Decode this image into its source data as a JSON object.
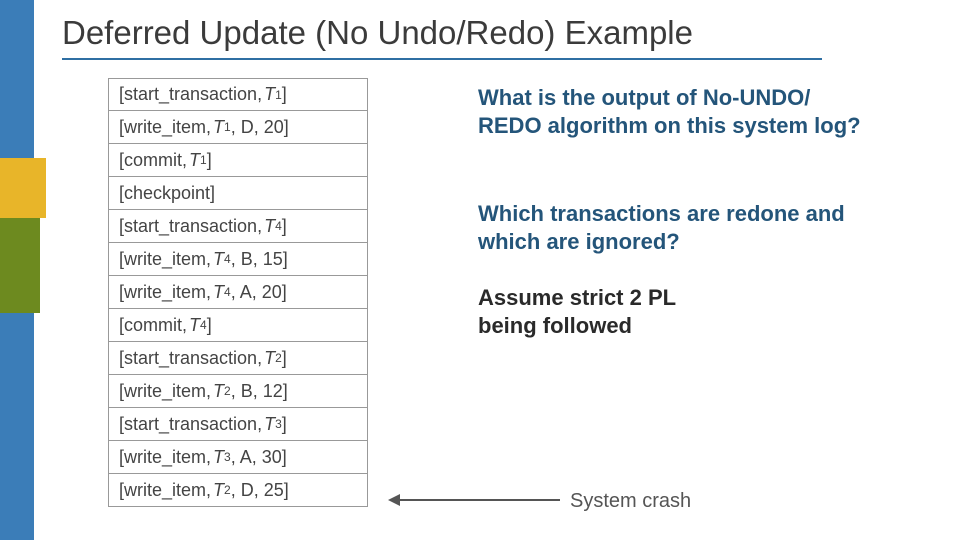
{
  "title": "Deferred Update (No Undo/Redo) Example",
  "log": {
    "rows": [
      {
        "op": "[start_transaction, ",
        "txn": "T",
        "sub": "1",
        "tail": "]"
      },
      {
        "op": "[write_item, ",
        "txn": "T",
        "sub": "1",
        "tail": ", D, 20]"
      },
      {
        "op": "[commit, ",
        "txn": "T",
        "sub": "1",
        "tail": "]"
      },
      {
        "op": "[checkpoint]",
        "txn": "",
        "sub": "",
        "tail": ""
      },
      {
        "op": "[start_transaction, ",
        "txn": "T",
        "sub": "4",
        "tail": "]"
      },
      {
        "op": "[write_item, ",
        "txn": "T",
        "sub": "4",
        "tail": ", B, 15]"
      },
      {
        "op": "[write_item, ",
        "txn": "T",
        "sub": "4",
        "tail": ", A, 20]"
      },
      {
        "op": "[commit, ",
        "txn": "T",
        "sub": "4",
        "tail": "]"
      },
      {
        "op": "[start_transaction, ",
        "txn": "T",
        "sub": "2",
        "tail": "]"
      },
      {
        "op": "[write_item, ",
        "txn": "T",
        "sub": "2",
        "tail": ", B, 12]"
      },
      {
        "op": "[start_transaction, ",
        "txn": "T",
        "sub": "3",
        "tail": "]"
      },
      {
        "op": "[write_item, ",
        "txn": "T",
        "sub": "3",
        "tail": ", A, 30]"
      },
      {
        "op": "[write_item, ",
        "txn": "T",
        "sub": "2",
        "tail": ", D, 25]"
      }
    ]
  },
  "questions": {
    "q1": "What is the output of No-UNDO/ REDO algorithm on this system log?",
    "q2": "Which transactions are redone and which are ignored?",
    "q3": "Assume strict 2 PL being followed"
  },
  "crash_label": "System crash"
}
